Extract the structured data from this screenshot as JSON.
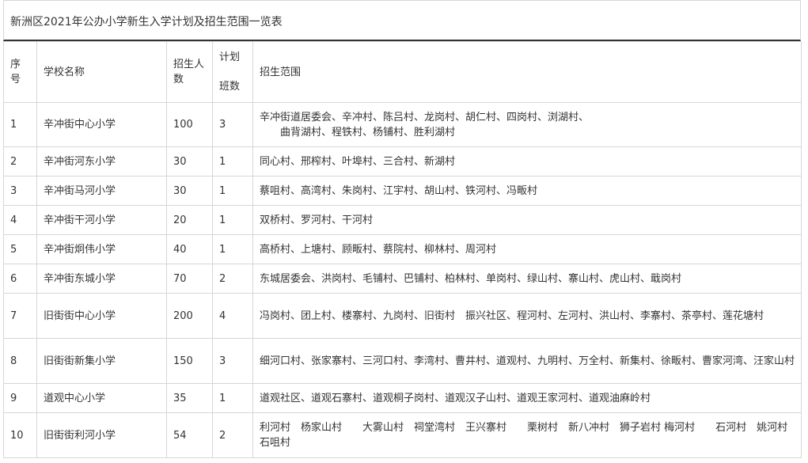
{
  "title": "新洲区2021年公办小学新生入学计划及招生范围一览表",
  "headers": {
    "no": [
      "序",
      "号"
    ],
    "school": "学校名称",
    "enroll": [
      "招生人",
      "数"
    ],
    "plan": [
      "计划",
      "班数"
    ],
    "range": "招生范围"
  },
  "rows": [
    {
      "no": "1",
      "school": "辛冲街中心小学",
      "enroll": "100",
      "classes": "3",
      "range_lines": [
        "辛冲街道居委会、辛冲村、陈吕村、龙岗村、胡仁村、四岗村、浏湖村、",
        "曲背湖村、程铁村、杨铺村、胜利湖村"
      ]
    },
    {
      "no": "2",
      "school": "辛冲街河东小学",
      "enroll": "30",
      "classes": "1",
      "range_lines": [
        "同心村、邢榨村、叶埠村、三合村、新湖村"
      ]
    },
    {
      "no": "3",
      "school": "辛冲街马河小学",
      "enroll": "30",
      "classes": "1",
      "range_lines": [
        "蔡咀村、高湾村、朱岗村、江宇村、胡山村、铁河村、冯畈村"
      ]
    },
    {
      "no": "4",
      "school": "辛冲街干河小学",
      "enroll": "20",
      "classes": "1",
      "range_lines": [
        "双桥村、罗河村、干河村"
      ]
    },
    {
      "no": "5",
      "school": "辛冲街炯伟小学",
      "enroll": "40",
      "classes": "1",
      "range_lines": [
        "高桥村、上塘村、顾畈村、蔡院村、柳林村、周河村"
      ]
    },
    {
      "no": "6",
      "school": "辛冲街东城小学",
      "enroll": "70",
      "classes": "2",
      "range_lines": [
        "东城居委会、洪岗村、毛铺村、巴铺村、柏林村、单岗村、绿山村、寨山村、虎山村、戢岗村"
      ]
    },
    {
      "no": "7",
      "school": "旧街街中心小学",
      "enroll": "200",
      "classes": "4",
      "range_lines": [
        "冯岗村、团上村、楼寨村、九岗村、旧街村　振兴社区、程河村、左河村、洪山村、李寨村、茶亭村、莲花塘村"
      ]
    },
    {
      "no": "8",
      "school": "旧街街新集小学",
      "enroll": "150",
      "classes": "3",
      "range_lines": [
        "细河口村、张家寨村、三河口村、李湾村、曹井村、道观村、九明村、万全村、新集村、徐畈村、曹家河湾、汪家山村"
      ]
    },
    {
      "no": "9",
      "school": "道观中心小学",
      "enroll": "35",
      "classes": "1",
      "range_lines": [
        "道观社区、道观石寨村、道观桐子岗村、道观汉子山村、道观王家河村、道观油麻岭村"
      ]
    },
    {
      "no": "10",
      "school": "旧街街利河小学",
      "enroll": "54",
      "classes": "2",
      "range_lines": [
        "利河村　杨家山村　　大雾山村　祠堂湾村　王兴寨村　　栗树村　新八冲村　狮子岩村 梅河村　　石河村　姚河村 石咀村"
      ]
    }
  ]
}
